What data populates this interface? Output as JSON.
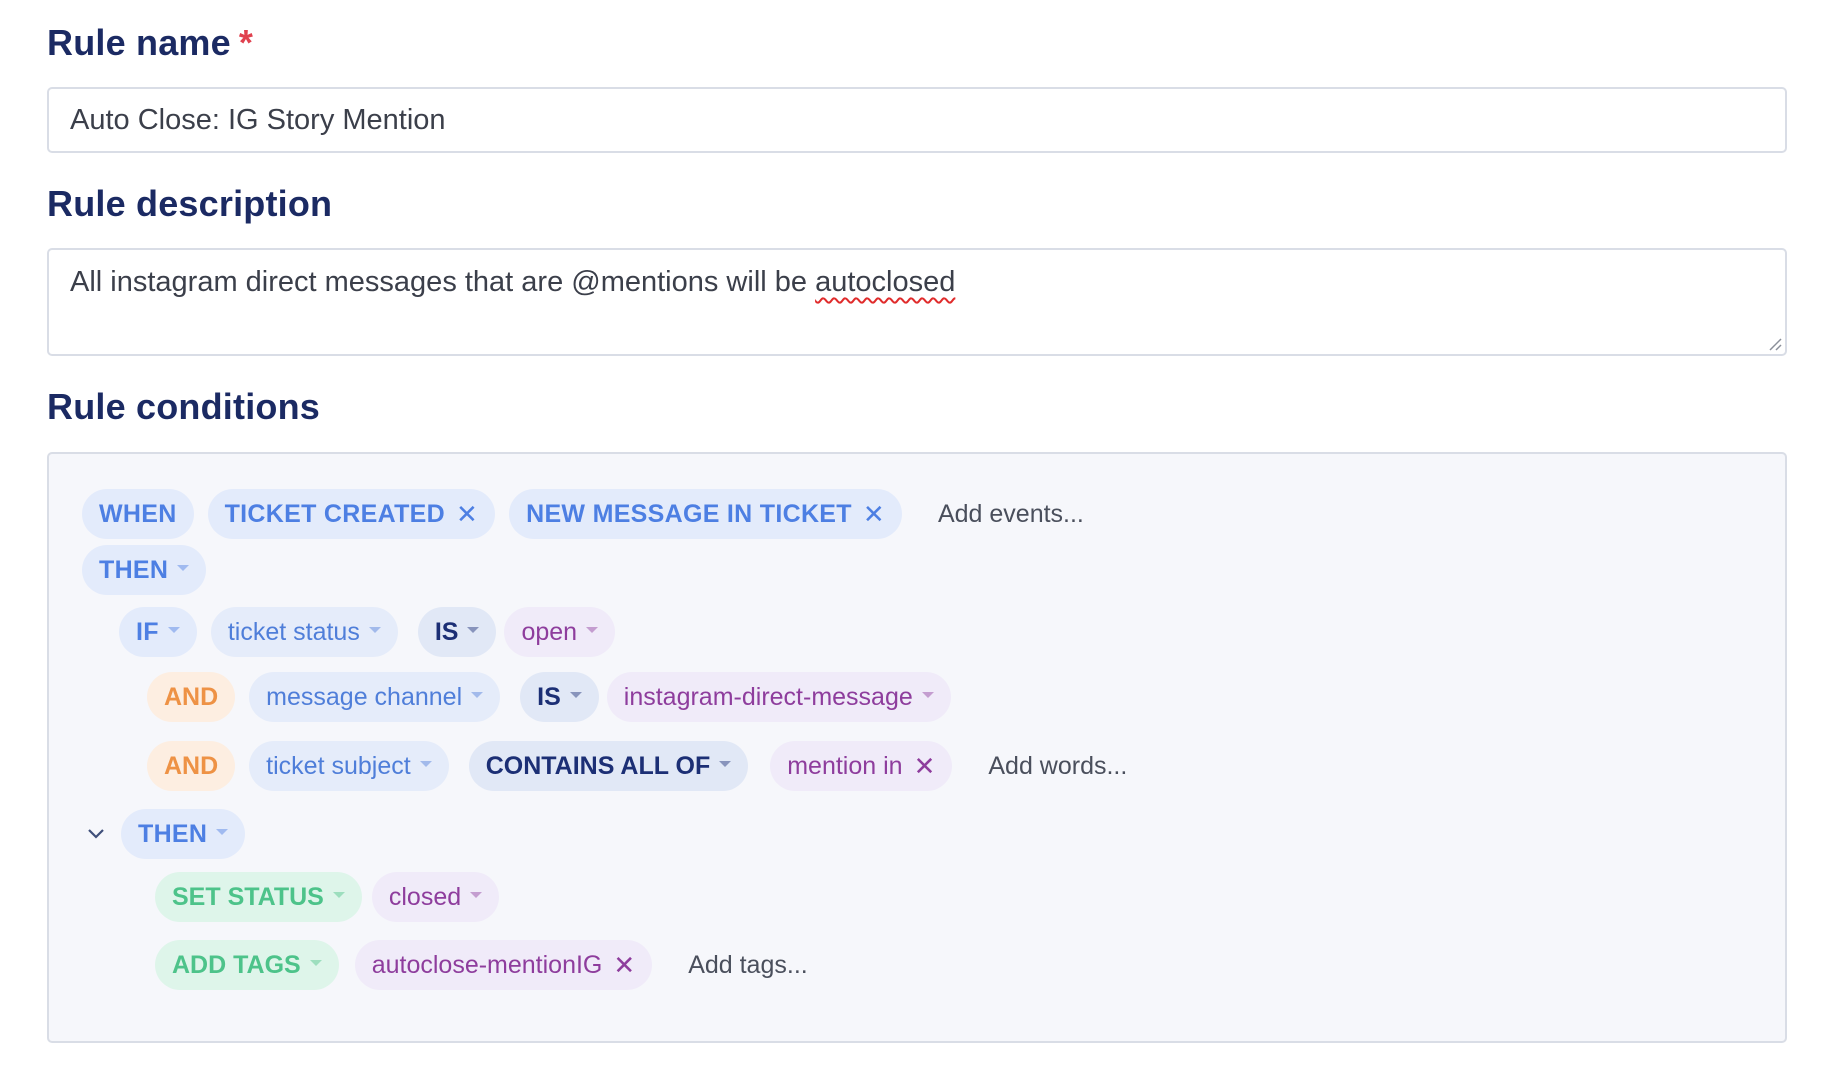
{
  "rule_name": {
    "label": "Rule name",
    "required_mark": "*",
    "value": "Auto Close: IG Story Mention"
  },
  "rule_description": {
    "label": "Rule description",
    "value_prefix": "All instagram direct messages that are @mentions will be ",
    "value_misspelled": "autoclosed"
  },
  "conditions": {
    "label": "Rule conditions",
    "when": {
      "keyword": "WHEN",
      "events": [
        "TICKET CREATED",
        "NEW MESSAGE IN TICKET"
      ],
      "add_placeholder": "Add events..."
    },
    "then_1": "THEN",
    "if_row": {
      "keyword": "IF",
      "field": "ticket status",
      "operator": "IS",
      "value": "open"
    },
    "and_row_1": {
      "keyword": "AND",
      "field": "message channel",
      "operator": "IS",
      "value": "instagram-direct-message"
    },
    "and_row_2": {
      "keyword": "AND",
      "field": "ticket subject",
      "operator": "CONTAINS ALL OF",
      "value": "mention in",
      "add_placeholder": "Add words..."
    },
    "then_2": "THEN",
    "set_status": {
      "action": "SET STATUS",
      "value": "closed"
    },
    "add_tags": {
      "action": "ADD TAGS",
      "value": "autoclose-mentionIG",
      "add_placeholder": "Add tags..."
    }
  },
  "colors": {
    "heading": "#1b2a63",
    "required": "#e0424f",
    "blue_keyword": "#4d7fe3",
    "operator": "#1c2f75",
    "value": "#8e3d9d",
    "and": "#ee9245",
    "action": "#4dc38a"
  }
}
